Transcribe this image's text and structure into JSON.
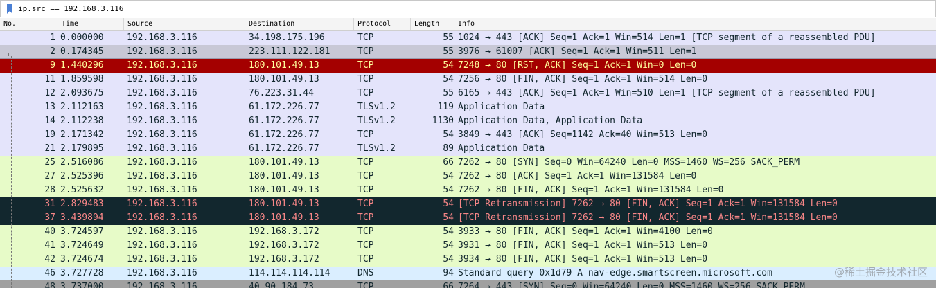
{
  "filter": {
    "value": "ip.src == 192.168.3.116",
    "icon": "bookmark-icon",
    "icon_color": "#4a7fd4"
  },
  "columns": [
    "No.",
    "Time",
    "Source",
    "Destination",
    "Protocol",
    "Length",
    "Info"
  ],
  "colors": {
    "tcp_green": "#e7fbc8",
    "lavender": "#e4e4fb",
    "dns_blue": "#daeeff",
    "rst_red": "#a40000",
    "bad_dark": "#12272e",
    "bad_text": "#f78687",
    "selected_gray": "#c8c8d6",
    "last_gray": "#a0a0a0"
  },
  "packets": [
    {
      "no": "1",
      "time": "0.000000",
      "src": "192.168.3.116",
      "dst": "34.198.175.196",
      "proto": "TCP",
      "len": "55",
      "info": "1024 → 443 [ACK] Seq=1 Ack=1 Win=514 Len=1 [TCP segment of a reassembled PDU]",
      "style": "lavender"
    },
    {
      "no": "2",
      "time": "0.174345",
      "src": "192.168.3.116",
      "dst": "223.111.122.181",
      "proto": "TCP",
      "len": "55",
      "info": "3976 → 61007 [ACK] Seq=1 Ack=1 Win=511 Len=1",
      "style": "selected_gray"
    },
    {
      "no": "9",
      "time": "1.440296",
      "src": "192.168.3.116",
      "dst": "180.101.49.13",
      "proto": "TCP",
      "len": "54",
      "info": "7248 → 80 [RST, ACK] Seq=1 Ack=1 Win=0 Len=0",
      "style": "rst_red"
    },
    {
      "no": "11",
      "time": "1.859598",
      "src": "192.168.3.116",
      "dst": "180.101.49.13",
      "proto": "TCP",
      "len": "54",
      "info": "7256 → 80 [FIN, ACK] Seq=1 Ack=1 Win=514 Len=0",
      "style": "lavender"
    },
    {
      "no": "12",
      "time": "2.093675",
      "src": "192.168.3.116",
      "dst": "76.223.31.44",
      "proto": "TCP",
      "len": "55",
      "info": "6165 → 443 [ACK] Seq=1 Ack=1 Win=510 Len=1 [TCP segment of a reassembled PDU]",
      "style": "lavender"
    },
    {
      "no": "13",
      "time": "2.112163",
      "src": "192.168.3.116",
      "dst": "61.172.226.77",
      "proto": "TLSv1.2",
      "len": "119",
      "info": "Application Data",
      "style": "lavender"
    },
    {
      "no": "14",
      "time": "2.112238",
      "src": "192.168.3.116",
      "dst": "61.172.226.77",
      "proto": "TLSv1.2",
      "len": "1130",
      "info": "Application Data, Application Data",
      "style": "lavender"
    },
    {
      "no": "19",
      "time": "2.171342",
      "src": "192.168.3.116",
      "dst": "61.172.226.77",
      "proto": "TCP",
      "len": "54",
      "info": "3849 → 443 [ACK] Seq=1142 Ack=40 Win=513 Len=0",
      "style": "lavender"
    },
    {
      "no": "21",
      "time": "2.179895",
      "src": "192.168.3.116",
      "dst": "61.172.226.77",
      "proto": "TLSv1.2",
      "len": "89",
      "info": "Application Data",
      "style": "lavender"
    },
    {
      "no": "25",
      "time": "2.516086",
      "src": "192.168.3.116",
      "dst": "180.101.49.13",
      "proto": "TCP",
      "len": "66",
      "info": "7262 → 80 [SYN] Seq=0 Win=64240 Len=0 MSS=1460 WS=256 SACK_PERM",
      "style": "tcp_green"
    },
    {
      "no": "27",
      "time": "2.525396",
      "src": "192.168.3.116",
      "dst": "180.101.49.13",
      "proto": "TCP",
      "len": "54",
      "info": "7262 → 80 [ACK] Seq=1 Ack=1 Win=131584 Len=0",
      "style": "tcp_green"
    },
    {
      "no": "28",
      "time": "2.525632",
      "src": "192.168.3.116",
      "dst": "180.101.49.13",
      "proto": "TCP",
      "len": "54",
      "info": "7262 → 80 [FIN, ACK] Seq=1 Ack=1 Win=131584 Len=0",
      "style": "tcp_green"
    },
    {
      "no": "31",
      "time": "2.829483",
      "src": "192.168.3.116",
      "dst": "180.101.49.13",
      "proto": "TCP",
      "len": "54",
      "info": "[TCP Retransmission] 7262 → 80 [FIN, ACK] Seq=1 Ack=1 Win=131584 Len=0",
      "style": "bad_dark"
    },
    {
      "no": "37",
      "time": "3.439894",
      "src": "192.168.3.116",
      "dst": "180.101.49.13",
      "proto": "TCP",
      "len": "54",
      "info": "[TCP Retransmission] 7262 → 80 [FIN, ACK] Seq=1 Ack=1 Win=131584 Len=0",
      "style": "bad_dark"
    },
    {
      "no": "40",
      "time": "3.724597",
      "src": "192.168.3.116",
      "dst": "192.168.3.172",
      "proto": "TCP",
      "len": "54",
      "info": "3933 → 80 [FIN, ACK] Seq=1 Ack=1 Win=4100 Len=0",
      "style": "tcp_green"
    },
    {
      "no": "41",
      "time": "3.724649",
      "src": "192.168.3.116",
      "dst": "192.168.3.172",
      "proto": "TCP",
      "len": "54",
      "info": "3931 → 80 [FIN, ACK] Seq=1 Ack=1 Win=513 Len=0",
      "style": "tcp_green"
    },
    {
      "no": "42",
      "time": "3.724674",
      "src": "192.168.3.116",
      "dst": "192.168.3.172",
      "proto": "TCP",
      "len": "54",
      "info": "3934 → 80 [FIN, ACK] Seq=1 Ack=1 Win=513 Len=0",
      "style": "tcp_green"
    },
    {
      "no": "46",
      "time": "3.727728",
      "src": "192.168.3.116",
      "dst": "114.114.114.114",
      "proto": "DNS",
      "len": "94",
      "info": "Standard query 0x1d79 A nav-edge.smartscreen.microsoft.com",
      "style": "dns_blue"
    },
    {
      "no": "48",
      "time": "3.737000",
      "src": "192.168.3.116",
      "dst": "40.90.184.73",
      "proto": "TCP",
      "len": "66",
      "info": "7264 → 443 [SYN] Seq=0 Win=64240 Len=0 MSS=1460 WS=256 SACK_PERM",
      "style": "last_gray"
    }
  ],
  "watermark": "@稀土掘金技术社区"
}
